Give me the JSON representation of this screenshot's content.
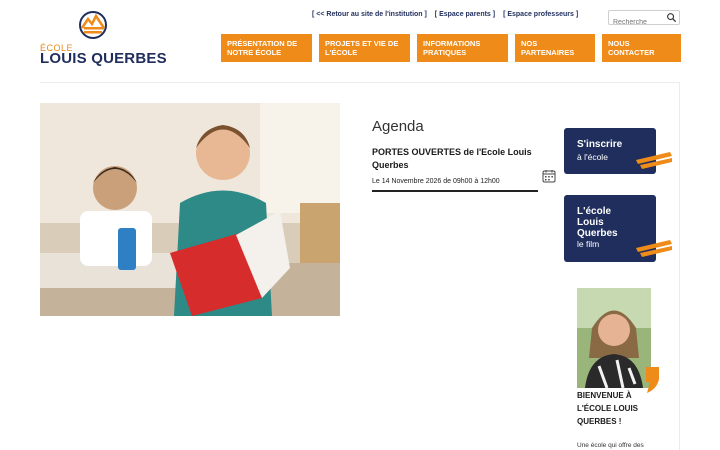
{
  "logo": {
    "small": "ÉCOLE",
    "big": "LOUIS QUERBES"
  },
  "toplinks": [
    "[ << Retour au site de l'institution ]",
    "[ Espace parents ]",
    "[ Espace professeurs ]"
  ],
  "search": {
    "placeholder": "Recherche"
  },
  "nav": [
    "PRÉSENTATION DE NOTRE ÉCOLE",
    "PROJETS ET VIE DE L'ÉCOLE",
    "INFORMATIONS PRATIQUES",
    "NOS PARTENAIRES",
    "NOUS CONTACTER"
  ],
  "agenda": {
    "title": "Agenda",
    "event_title": "PORTES OUVERTES de l'Ecole Louis Querbes",
    "event_date": "Le 14 Novembre 2026 de 09h00 à 12h00"
  },
  "cta1": {
    "title": "S'inscrire",
    "sub": "à l'école"
  },
  "cta2": {
    "title": "L'école Louis Querbes",
    "sub": "le film"
  },
  "welcome": {
    "title": "BIENVENUE À L'ÉCOLE LOUIS QUERBES !",
    "text": "Une école qui offre des"
  },
  "colors": {
    "orange": "#ef8b18",
    "navy": "#1f2e5c"
  }
}
